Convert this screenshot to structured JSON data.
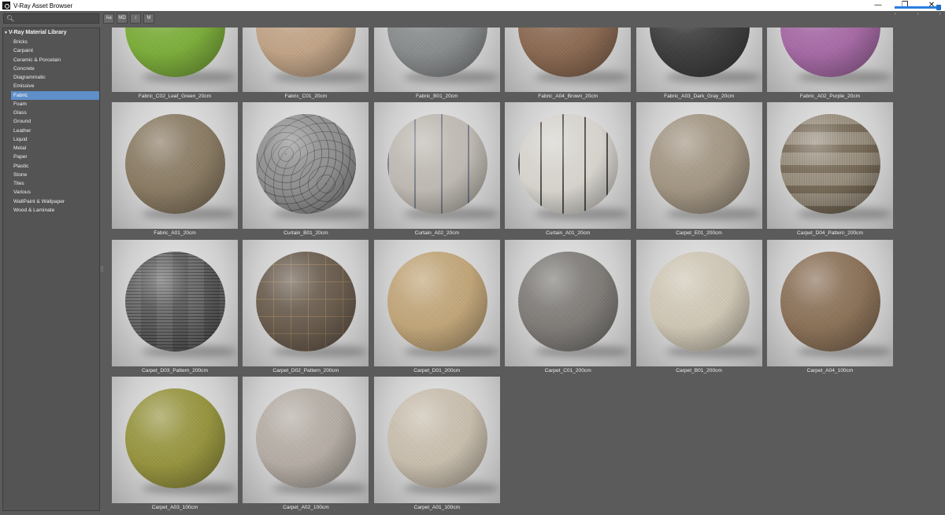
{
  "window": {
    "title": "V-Ray Asset Browser",
    "controls": {
      "minimize": "—",
      "restore": "❐",
      "close": "✕"
    }
  },
  "toolbar": {
    "search_placeholder": "",
    "buttons": [
      {
        "label": "Aa",
        "name": "case-toggle-button"
      },
      {
        "label": "MD",
        "name": "md-filter-button"
      },
      {
        "label": "↕",
        "name": "sort-button"
      },
      {
        "label": "M",
        "name": "m-filter-button"
      }
    ],
    "thumbnail_size": 0.97
  },
  "sidebar": {
    "root_label": "V-Ray Material Library",
    "items": [
      "Bricks",
      "Carpaint",
      "Ceramic & Porcelain",
      "Concrete",
      "Diagrammatic",
      "Emissive",
      "Fabric",
      "Foam",
      "Glass",
      "Ground",
      "Leather",
      "Liquid",
      "Metal",
      "Paper",
      "Plastic",
      "Stone",
      "Tiles",
      "Various",
      "WallPaint & Wallpaper",
      "Wood & Laminate"
    ],
    "selected": "Fabric"
  },
  "materials": [
    {
      "name": "Fabric_C02_Leaf_Green_20cm",
      "color": "#7cae3a"
    },
    {
      "name": "Fabric_C01_20cm",
      "color": "#c2a487"
    },
    {
      "name": "Fabric_B01_20cm",
      "color": "#8a8d8e"
    },
    {
      "name": "Fabric_A04_Brown_20cm",
      "color": "#8c6a52"
    },
    {
      "name": "Fabric_A03_Dark_Gray_20cm",
      "color": "#3e3e3e"
    },
    {
      "name": "Fabric_A02_Purple_20cm",
      "color": "#a76aa6"
    },
    {
      "name": "Fabric_A01_20cm",
      "color": "#8a7b63"
    },
    {
      "name": "Curtain_B01_20cm",
      "color": "#8f8f8f"
    },
    {
      "name": "Curtain_A02_20cm",
      "color": "#bdb8b1"
    },
    {
      "name": "Curtain_A01_20cm",
      "color": "#d5d2cc"
    },
    {
      "name": "Carpet_E01_200cm",
      "color": "#a39683"
    },
    {
      "name": "Carpet_D04_Pattern_200cm",
      "color": "#9a9080"
    },
    {
      "name": "Carpet_D03_Pattern_200cm",
      "color": "#5c5c5c"
    },
    {
      "name": "Carpet_D02_Pattern_200cm",
      "color": "#6a5d4f"
    },
    {
      "name": "Carpet_D01_200cm",
      "color": "#c2a679"
    },
    {
      "name": "Carpet_C01_200cm",
      "color": "#7f7c78"
    },
    {
      "name": "Carpet_B01_200cm",
      "color": "#d0c8b6"
    },
    {
      "name": "Carpet_A04_100cm",
      "color": "#8b7157"
    },
    {
      "name": "Carpet_A03_100cm",
      "color": "#97953e"
    },
    {
      "name": "Carpet_A02_100cm",
      "color": "#b5ada5"
    },
    {
      "name": "Carpet_A01_100cm",
      "color": "#c9bfae"
    }
  ],
  "patterns": {
    "Curtain_B01_20cm": "floral",
    "Curtain_A02_20cm": "stripes",
    "Curtain_A01_20cm": "stripes-dark",
    "Carpet_D04_Pattern_200cm": "patch",
    "Carpet_D03_Pattern_200cm": "tiles",
    "Carpet_D02_Pattern_200cm": "grid"
  }
}
